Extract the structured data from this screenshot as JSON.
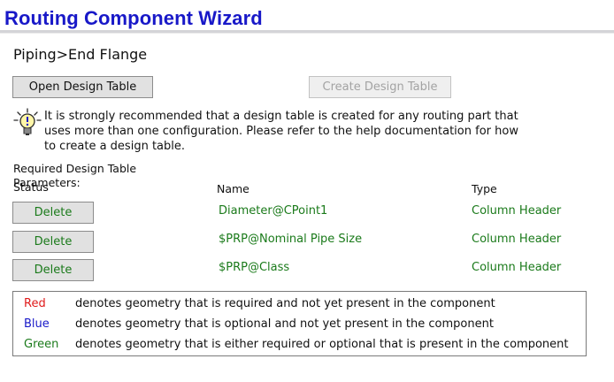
{
  "header": {
    "title": "Routing Component Wizard"
  },
  "breadcrumb": "Piping>End Flange",
  "toolbar": {
    "open_design_table": "Open Design Table",
    "create_design_table": "Create Design Table"
  },
  "info": {
    "icon": "lightbulb-info-icon",
    "message": "It is strongly recommended that a design table is created for any routing part that uses more than one configuration.  Please refer to the help documentation for how to create a design table."
  },
  "params": {
    "label": "Required Design Table Parameters:",
    "columns": {
      "status": "Status",
      "name": "Name",
      "type": "Type"
    },
    "rows": [
      {
        "action": "Delete",
        "name": "Diameter@CPoint1",
        "type": "Column Header"
      },
      {
        "action": "Delete",
        "name": "$PRP@Nominal Pipe Size",
        "type": "Column Header"
      },
      {
        "action": "Delete",
        "name": "$PRP@Class",
        "type": "Column Header"
      }
    ]
  },
  "legend": [
    {
      "label": "Red",
      "color": "#e01b1b",
      "description": "denotes geometry that is required and not yet present in the component"
    },
    {
      "label": "Blue",
      "color": "#1818c8",
      "description": "denotes geometry that is optional and not yet present in the component"
    },
    {
      "label": "Green",
      "color": "#1a7a1a",
      "description": "denotes geometry that is either required or optional that is present in the component"
    }
  ]
}
